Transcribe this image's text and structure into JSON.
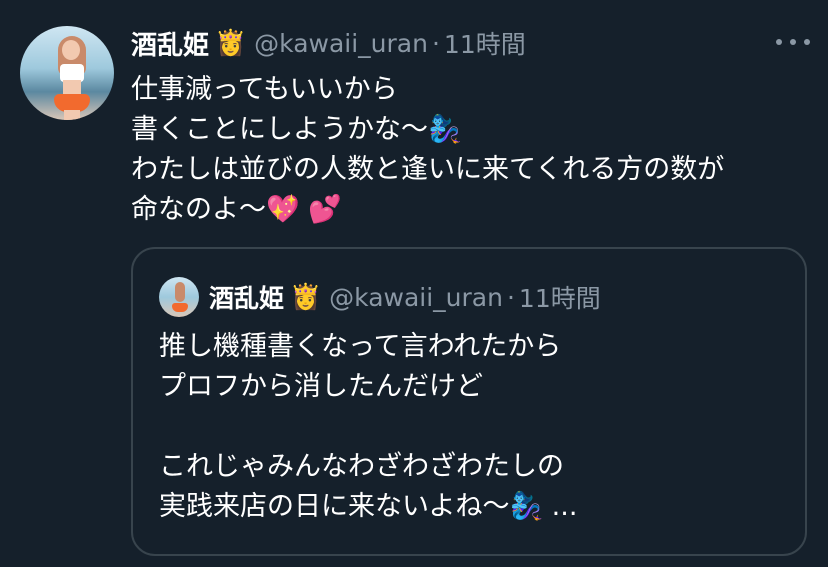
{
  "tweet": {
    "author_name": "酒乱姫",
    "author_emoji": "👸",
    "handle": "@kawaii_uran",
    "separator": "·",
    "time": "11時間",
    "text_lines": [
      "仕事減ってもいいから",
      "書くことにしようかな〜🧞‍♀️",
      "わたしは並びの人数と逢いに来てくれる方の数が",
      "命なのよ〜💖 💕"
    ]
  },
  "quoted_tweet": {
    "author_name": "酒乱姫",
    "author_emoji": "👸",
    "handle": "@kawaii_uran",
    "separator": "·",
    "time": "11時間",
    "text_lines": [
      "推し機種書くなって言われたから",
      "プロフから消したんだけど",
      "",
      "これじゃみんなわざわざわたしの",
      "実践来店の日に来ないよね〜🧞‍♀️ ..."
    ]
  },
  "icons": {
    "more": "more-horizontal-icon",
    "avatar": "profile-avatar"
  },
  "colors": {
    "background": "#15202b",
    "secondary_text": "#8b98a5",
    "border": "#38444d",
    "primary_text": "#ffffff"
  }
}
